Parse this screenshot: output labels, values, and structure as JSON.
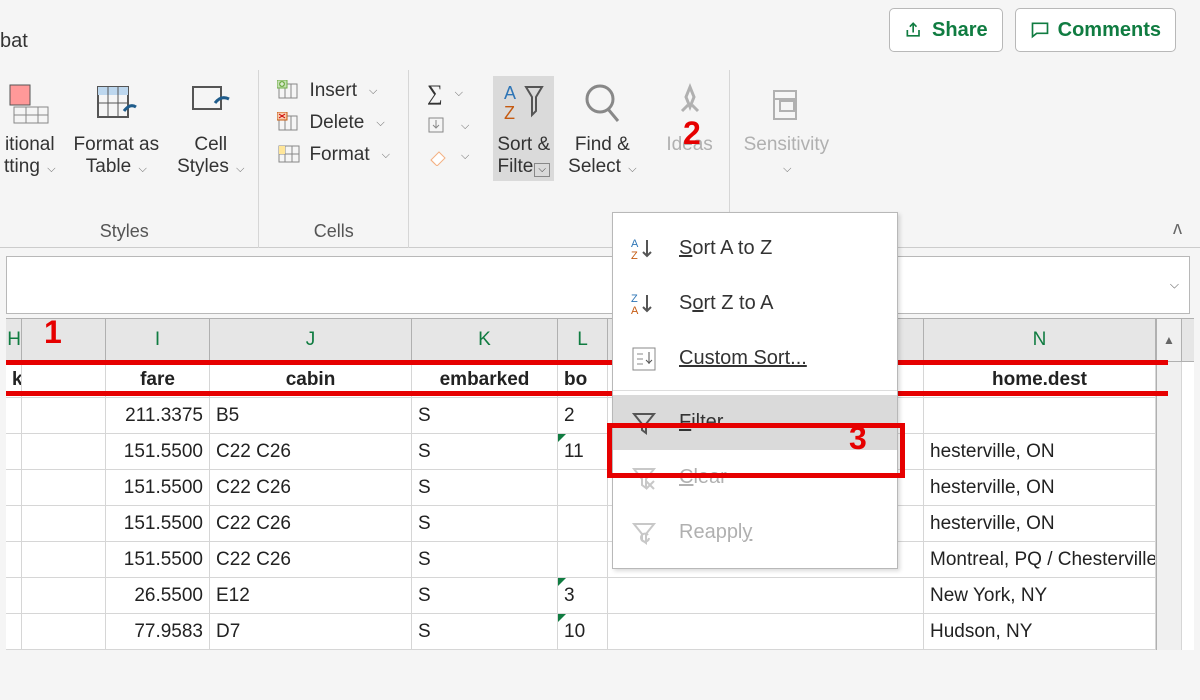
{
  "ribbon_tab_partial": "bat",
  "topbuttons": {
    "share": "Share",
    "comments": "Comments"
  },
  "styles_group": {
    "conditional_l1": "itional",
    "conditional_l2": "tting",
    "format_as_l1": "Format as",
    "format_as_l2": "Table",
    "cell_l1": "Cell",
    "cell_l2": "Styles",
    "label": "Styles"
  },
  "cells_group": {
    "insert": "Insert",
    "delete": "Delete",
    "format": "Format",
    "label": "Cells"
  },
  "editing_group": {
    "sort_l1": "Sort &",
    "sort_l2": "Filte",
    "find_l1": "Find &",
    "find_l2": "Select"
  },
  "ideas_group": {
    "ideas": "Ideas"
  },
  "sensitivity_group": {
    "sensitivity": "Sensitivity",
    "label": "Sensitivity"
  },
  "dropdown": {
    "sort_az": "ort A to Z",
    "sort_za": "rt Z to A",
    "custom": "Custom Sort...",
    "filter": "ilter",
    "clear": "lear",
    "reapply": "Reappl"
  },
  "columns": {
    "h_partial": "H",
    "i": "I",
    "j": "J",
    "k": "K",
    "l": "L",
    "n": "N"
  },
  "headers": {
    "ticket": "ket",
    "fare": "fare",
    "cabin": "cabin",
    "embarked": "embarked",
    "boat": "bo",
    "home_dest": "home.dest"
  },
  "rows": [
    {
      "fare": "211.3375",
      "cabin": "B5",
      "embarked": "S",
      "boat": "2",
      "home": ""
    },
    {
      "fare": "151.5500",
      "cabin": "C22 C26",
      "embarked": "S",
      "boat": "11",
      "home": "hesterville, ON"
    },
    {
      "fare": "151.5500",
      "cabin": "C22 C26",
      "embarked": "S",
      "boat": "",
      "home": "hesterville, ON"
    },
    {
      "fare": "151.5500",
      "cabin": "C22 C26",
      "embarked": "S",
      "boat": "",
      "home": "hesterville, ON"
    },
    {
      "fare": "151.5500",
      "cabin": "C22 C26",
      "embarked": "S",
      "boat": "",
      "home": "Montreal, PQ / Chesterville, ON"
    },
    {
      "fare": "26.5500",
      "cabin": "E12",
      "embarked": "S",
      "boat": "3",
      "home": "New York, NY"
    },
    {
      "fare": "77.9583",
      "cabin": "D7",
      "embarked": "S",
      "boat": "10",
      "home": "Hudson, NY"
    }
  ],
  "annotations": {
    "one": "1",
    "two": "2",
    "three": "3"
  }
}
